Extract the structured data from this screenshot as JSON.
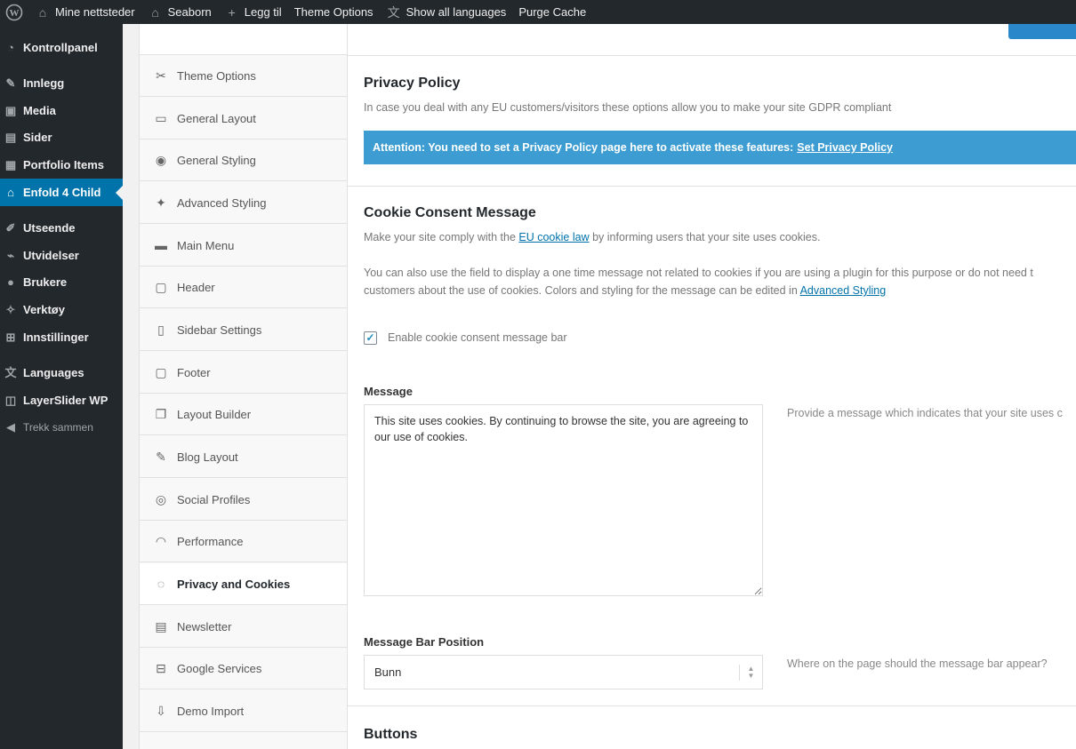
{
  "adminbar": {
    "items": [
      {
        "icon": "sites-icon",
        "label": "Mine nettsteder"
      },
      {
        "icon": "home-icon",
        "label": "Seaborn"
      },
      {
        "icon": "plus-icon",
        "label": "Legg til"
      },
      {
        "icon": "",
        "label": "Theme Options"
      },
      {
        "icon": "translate-icon",
        "label": "Show all languages"
      },
      {
        "icon": "",
        "label": "Purge Cache"
      }
    ]
  },
  "adminmenu": {
    "items": [
      {
        "icon": "dashboard-icon",
        "label": "Kontrollpanel"
      },
      {
        "icon": "pin-icon",
        "label": "Innlegg"
      },
      {
        "icon": "media-icon",
        "label": "Media"
      },
      {
        "icon": "page-icon",
        "label": "Sider"
      },
      {
        "icon": "portfolio-icon",
        "label": "Portfolio Items"
      },
      {
        "icon": "home-icon",
        "label": "Enfold 4 Child"
      },
      {
        "icon": "brush-icon",
        "label": "Utseende"
      },
      {
        "icon": "plugin-icon",
        "label": "Utvidelser"
      },
      {
        "icon": "user-icon",
        "label": "Brukere"
      },
      {
        "icon": "wrench-icon",
        "label": "Verktøy"
      },
      {
        "icon": "settings-icon",
        "label": "Innstillinger"
      },
      {
        "icon": "translate-icon",
        "label": "Languages"
      },
      {
        "icon": "layers-icon",
        "label": "LayerSlider WP"
      },
      {
        "icon": "collapse-icon",
        "label": "Trekk sammen"
      }
    ]
  },
  "optnav": {
    "items": [
      {
        "icon": "tools-icon",
        "label": "Theme Options"
      },
      {
        "icon": "layout-icon",
        "label": "General Layout"
      },
      {
        "icon": "palette-icon",
        "label": "General Styling"
      },
      {
        "icon": "wand-icon",
        "label": "Advanced Styling"
      },
      {
        "icon": "menu-icon",
        "label": "Main Menu"
      },
      {
        "icon": "header-icon",
        "label": "Header"
      },
      {
        "icon": "sidebar-icon",
        "label": "Sidebar Settings"
      },
      {
        "icon": "footer-icon",
        "label": "Footer"
      },
      {
        "icon": "builder-icon",
        "label": "Layout Builder"
      },
      {
        "icon": "blog-icon",
        "label": "Blog Layout"
      },
      {
        "icon": "social-icon",
        "label": "Social Profiles"
      },
      {
        "icon": "gauge-icon",
        "label": "Performance"
      },
      {
        "icon": "cookie-icon",
        "label": "Privacy and Cookies"
      },
      {
        "icon": "newsletter-icon",
        "label": "Newsletter"
      },
      {
        "icon": "map-icon",
        "label": "Google Services"
      },
      {
        "icon": "import-icon",
        "label": "Demo Import"
      }
    ]
  },
  "privacy": {
    "title": "Privacy Policy",
    "desc": "In case you deal with any EU customers/visitors these options allow you to make your site GDPR compliant",
    "attention_text": "Attention: You need to set a Privacy Policy page here to activate these features:",
    "attention_link": "Set Privacy Policy"
  },
  "cookie": {
    "title": "Cookie Consent Message",
    "desc_pre": "Make your site comply with the",
    "desc_link": "EU cookie law",
    "desc_post": "by informing users that your site uses cookies.",
    "desc2_line1": "You can also use the field to display a one time message not related to cookies if you are using a plugin for this purpose or do not need t",
    "desc2_line2_pre": "customers about the use of cookies. Colors and styling for the message can be edited in",
    "desc2_link": "Advanced Styling",
    "checkbox_label": "Enable cookie consent message bar",
    "checkbox_checked": true
  },
  "message": {
    "label": "Message",
    "value": "This site uses cookies. By continuing to browse the site, you are agreeing to our use of cookies.",
    "help": "Provide a message which indicates that your site uses c"
  },
  "position": {
    "label": "Message Bar Position",
    "value": "Bunn",
    "help": "Where on the page should the message bar appear?"
  },
  "buttons": {
    "title": "Buttons"
  }
}
